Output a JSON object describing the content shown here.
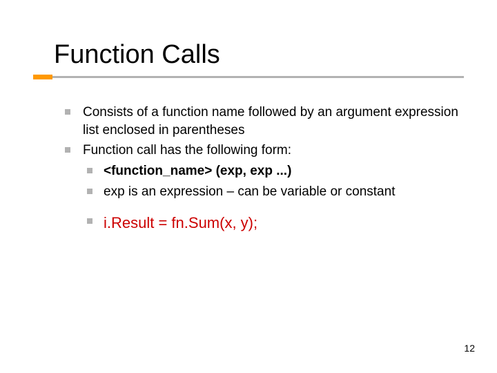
{
  "title": "Function Calls",
  "bullets": {
    "b1": "Consists of a function name followed by an argument expression list enclosed in parentheses",
    "b2": "Function call has the following form:",
    "sub1": "<function_name> (exp, exp ...)",
    "sub2": "exp is an expression – can be variable or constant",
    "sub3": "i.Result = fn.Sum(x, y);"
  },
  "pagenum": "12"
}
